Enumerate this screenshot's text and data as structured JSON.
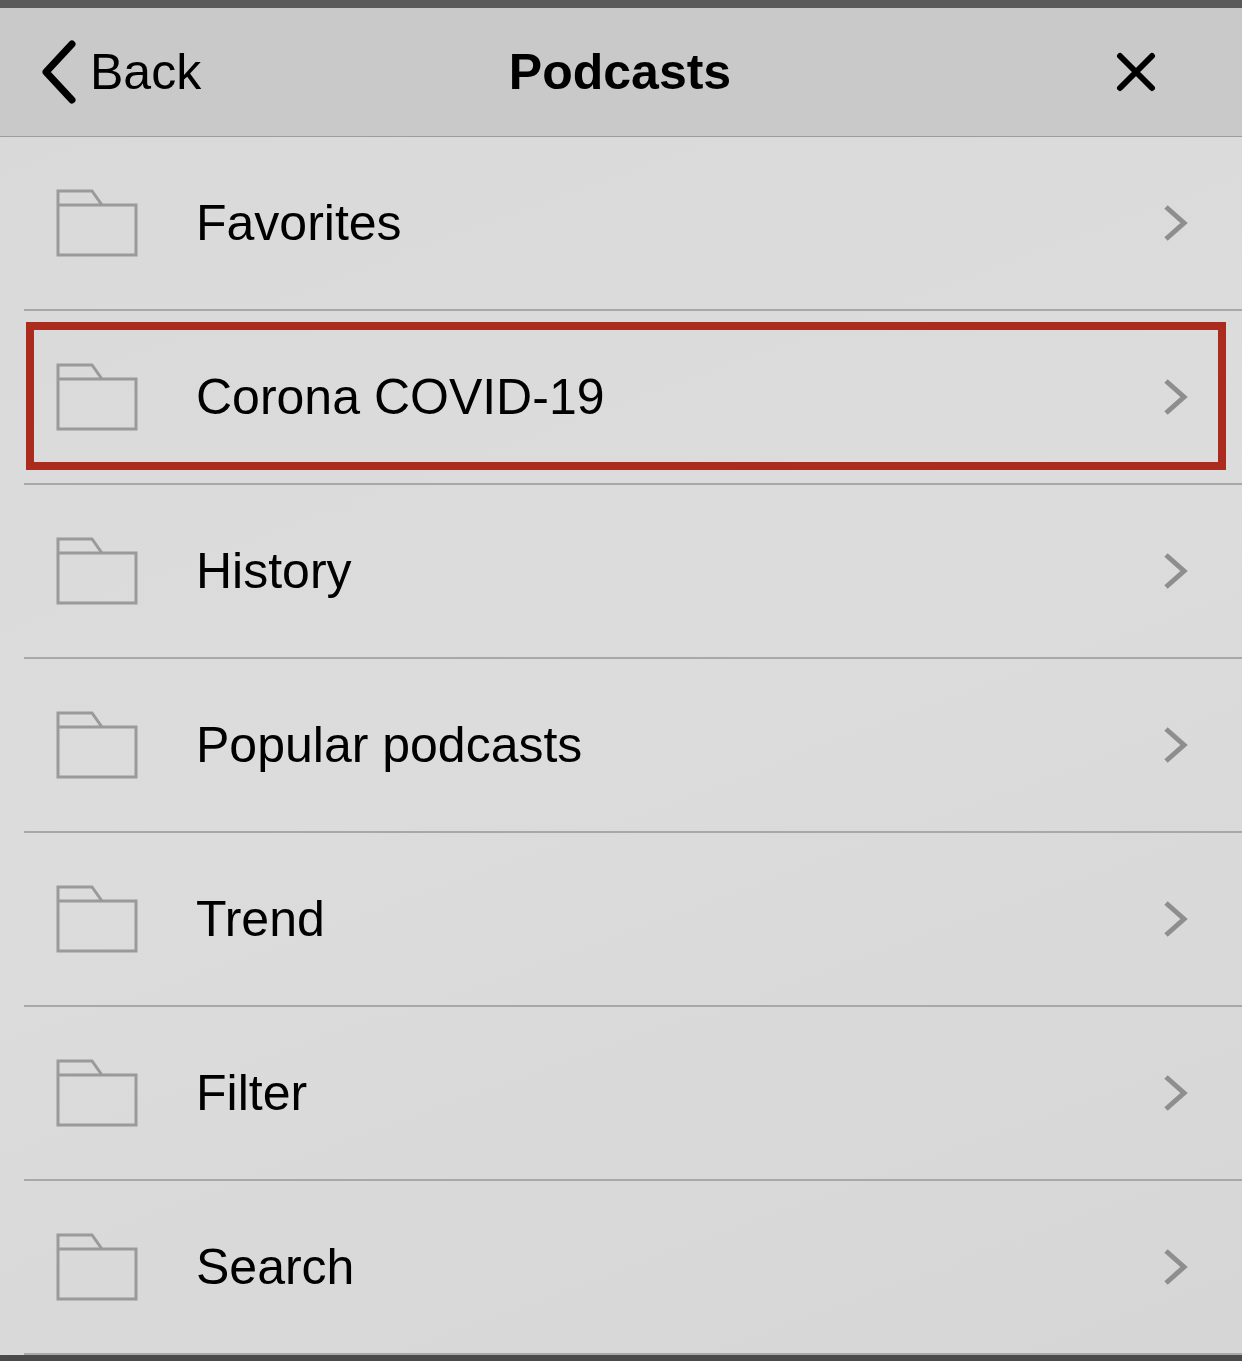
{
  "header": {
    "back_label": "Back",
    "title": "Podcasts"
  },
  "items": [
    {
      "label": "Favorites",
      "highlighted": false
    },
    {
      "label": "Corona COVID-19",
      "highlighted": true
    },
    {
      "label": "History",
      "highlighted": false
    },
    {
      "label": "Popular podcasts",
      "highlighted": false
    },
    {
      "label": "Trend",
      "highlighted": false
    },
    {
      "label": "Filter",
      "highlighted": false
    },
    {
      "label": "Search",
      "highlighted": false
    }
  ]
}
